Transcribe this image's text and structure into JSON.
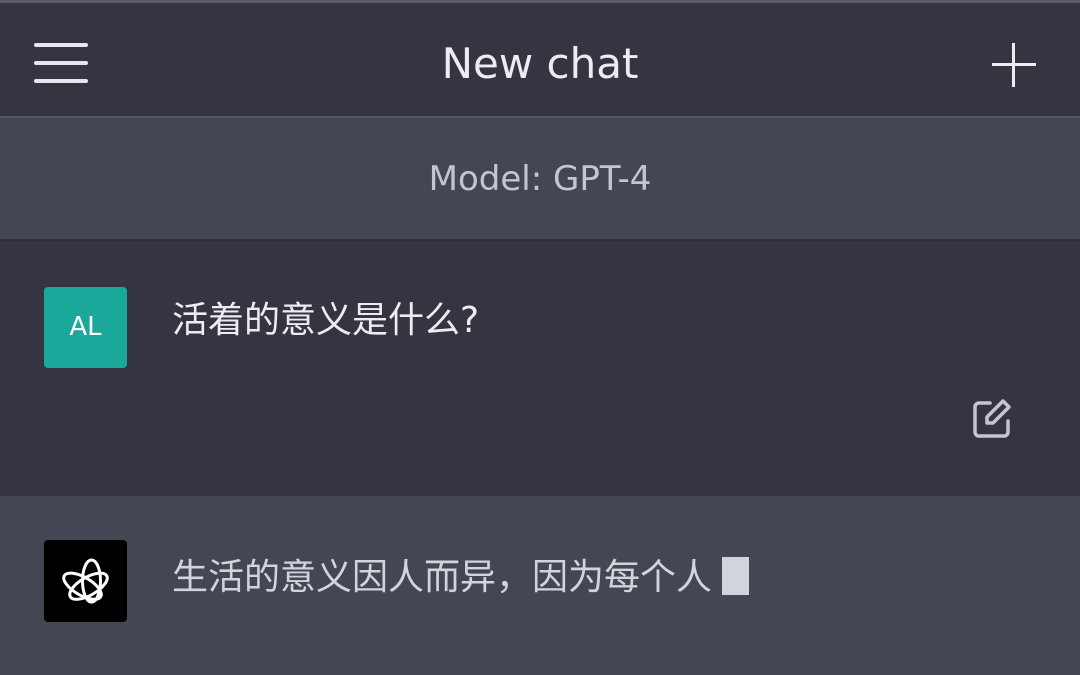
{
  "header": {
    "title": "New chat",
    "menu_icon": "hamburger-menu-icon",
    "new_icon": "plus-icon"
  },
  "model_bar": {
    "label": "Model: GPT-4"
  },
  "messages": [
    {
      "role": "user",
      "avatar": "AL",
      "avatar_color": "#19a89a",
      "text": "活着的意义是什么?",
      "action_icon": "edit-icon"
    },
    {
      "role": "assistant",
      "avatar_icon": "openai-logo-icon",
      "text": "生活的意义因人而异，因为每个人"
    }
  ],
  "colors": {
    "header_bg": "#343541",
    "assistant_bg": "#444654",
    "user_bg": "#343541"
  }
}
